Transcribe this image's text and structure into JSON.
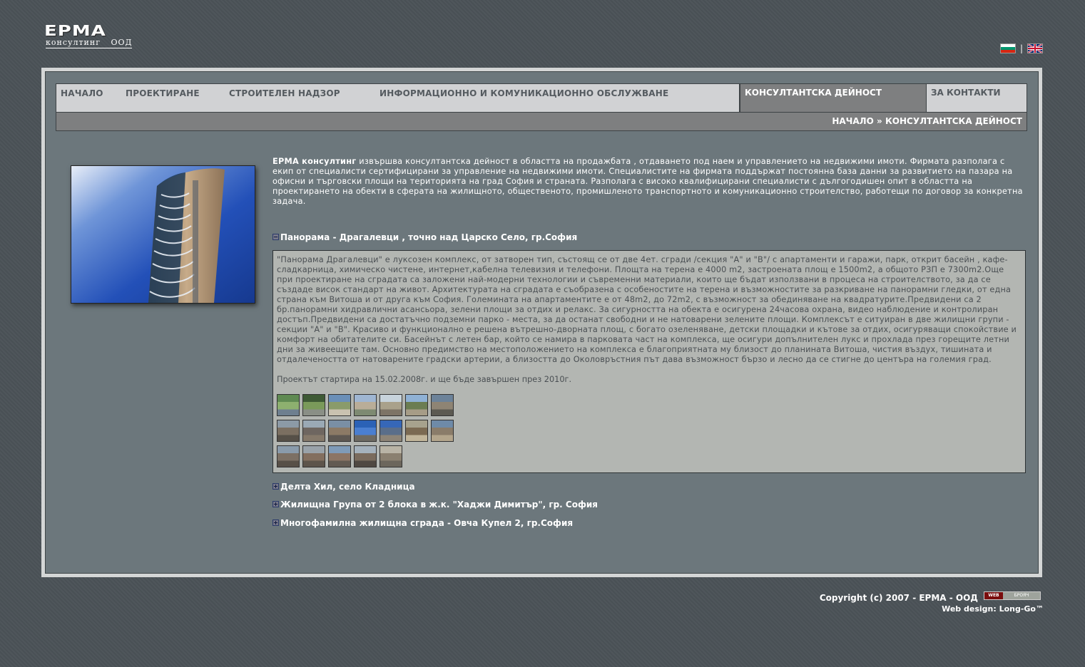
{
  "logo": {
    "main": "ЕРМА",
    "sub": "консултинг ООД"
  },
  "languages": [
    {
      "name": "bulgarian-flag",
      "colors": [
        "#ffffff",
        "#00966e",
        "#d62612"
      ]
    },
    {
      "name": "uk-flag",
      "colors": [
        "#012169",
        "#ffffff",
        "#c8102e"
      ]
    }
  ],
  "lang_separator": "|",
  "nav": {
    "items": [
      "НАЧАЛО",
      "ПРОЕКТИРАНЕ",
      "СТРОИТЕЛЕН НАДЗОР",
      "ИНФОРМАЦИОННО И КОМУНИКАЦИОННО ОБСЛУЖВАНЕ",
      "КОНСУЛТАНТСКА ДЕЙНОСТ",
      "ЗА КОНТАКТИ"
    ],
    "active": "КОНСУЛТАНТСКА ДЕЙНОСТ"
  },
  "breadcrumb": {
    "home": "НАЧАЛО",
    "separator": "»",
    "current": "КОНСУЛТАНТСКА ДЕЙНОСТ"
  },
  "intro": {
    "company": "ЕРМА консултинг",
    "text": " извършва консултантска дейност в областта на продажбата , отдаването под наем и управлението на недвижими имоти. Фирмата разполага с екип от специалисти сертифицирани за управление на недвижими имоти. Специалистите на фирмата поддържат постоянна база данни за развитието на пазара на офисни и търговски площи на територията на град София и страната. Разполага с високо квалифицирани специалисти с дългогодишен опит в областта на проектирането на обекти в сферата на жилищното, общественото, промишленото транспортното и комуникационно строителство, работещи по договор за конкретна задача."
  },
  "projects": [
    {
      "title": "Панорама - Драгалевци , точно над Царско Село, гр.София",
      "expanded": true,
      "description": "\"Панорама Драгалевци\" е луксозен комплекс, от затворен тип, състоящ се от две 4ет. сгради /секция \"А\" и \"В\"/ с апартаменти и гаражи, парк, открит басейн , кафе-сладкарница, химическо чистене, интернет,кабелна телевизия и телефони. Площта на терена е 4000 m2, застроената площ е 1500m2, а общото РЗП е 7300m2.Още при проектиране на сградата са заложени най-модерни технологии и съвременни материали, които ще бъдат използвани в процеса на строителството, за да се създаде висок стандарт на живот. Архитектурата на сградата е съобразена с особеностите на терена и възможностите за разкриване на панорамни гледки, от една страна към Витоша и от друга към София. Големината на апартаментите е от 48m2, до 72m2, с възможност за обединяване на квадратурите.Предвидени са 2 бр.панорамни хидравлични асансьора, зелени площи за отдих и релакс. За сигурността на обекта е осигурена 24часова охрана, видео наблюдение и контролиран достъп.Предвидени са достатъчно подземни парко - места, за да останат свободни и не натоварени зелените площи. Комплексът е ситуиран в две жилищни групи - секции \"А\" и \"В\". Красиво и функционално е решена вътрешно-дворната площ, с богато озеленяване, детски площадки и кътове за отдих, осигуряващи спокойствие и комфорт на обитателите си. Басейнът с летен бар, който се намира в парковата част на комплекса, ще осигури допълнителен лукс и прохлада през горещите летни дни за живеещите там. Основно предимство на местоположението на комплекса е благоприятната му близост до планината Витоша, чистия въздух, тишината и отдалечеността от натоварените градски артерии, а близостта до Околовръстния път дава възможност бързо и лесно да се стигне до центъра на големия град.",
      "start_note": "Проектът стартира на 15.02.2008г. и ще бъде завършен през 2010г.",
      "thumbnail_count": 19
    },
    {
      "title": "Делта Хил, село Кладница",
      "expanded": false
    },
    {
      "title": "Жилищна Група от 2 блока в ж.к. \"Хаджи Димитър\", гр. София",
      "expanded": false
    },
    {
      "title": "Многофамилна жилищна сграда - Овча Купел 2, гр.София",
      "expanded": false
    }
  ],
  "footer": {
    "copyright": "Copyright (c) 2007 - ЕРМА - ООД",
    "badge_left": "WEB",
    "badge_right": "БРОЯЧ",
    "webdesign": "Web design: Long-Go™"
  },
  "colors": {
    "background": "#4b5257",
    "content_bg": "#6c777c",
    "nav_bg": "#d1d2d4",
    "nav_active": "#7e7f80",
    "panel_bg": "#b3b6b2"
  }
}
